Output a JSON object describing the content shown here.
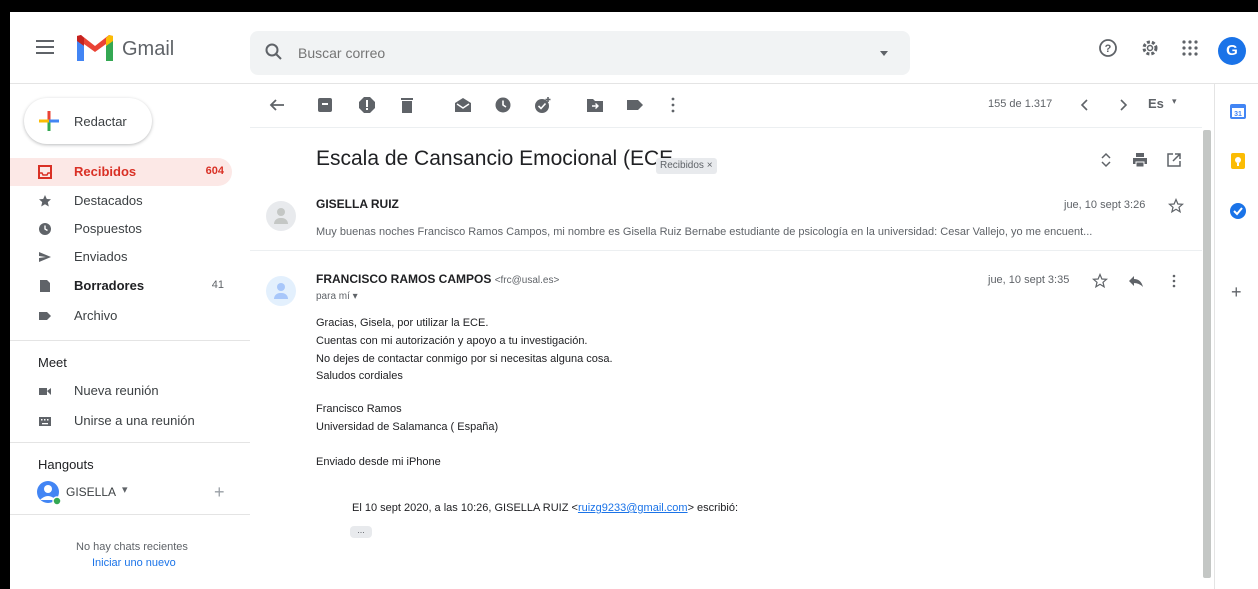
{
  "header": {
    "app_name": "Gmail",
    "search_placeholder": "Buscar correo",
    "avatar_letter": "G"
  },
  "sidebar": {
    "compose_label": "Redactar",
    "items": [
      {
        "label": "Recibidos",
        "count": "604",
        "icon": "inbox-icon"
      },
      {
        "label": "Destacados",
        "count": "",
        "icon": "star-icon"
      },
      {
        "label": "Pospuestos",
        "count": "",
        "icon": "clock-icon"
      },
      {
        "label": "Enviados",
        "count": "",
        "icon": "send-icon"
      },
      {
        "label": "Borradores",
        "count": "41",
        "icon": "draft-icon"
      },
      {
        "label": "Archivo",
        "count": "",
        "icon": "label-icon"
      }
    ],
    "meet": {
      "title": "Meet",
      "items": [
        {
          "label": "Nueva reunión",
          "icon": "video-icon"
        },
        {
          "label": "Unirse a una reunión",
          "icon": "keyboard-icon"
        }
      ]
    },
    "hangouts": {
      "title": "Hangouts",
      "user": "GISELLA",
      "no_chats": "No hay chats recientes",
      "start_new": "Iniciar uno nuevo"
    }
  },
  "toolbar": {
    "count": "155 de 1.317",
    "lang": "Es"
  },
  "thread": {
    "subject": "Escala de Cansancio Emocional (ECE",
    "label": "Recibidos ×",
    "messages": [
      {
        "sender": "GISELLA RUIZ",
        "date": "jue, 10 sept 3:26",
        "snippet": "Muy buenas noches Francisco Ramos Campos, mi nombre es Gisella Ruiz Bernabe estudiante de psicología en la universidad: Cesar Vallejo, yo me encuent..."
      },
      {
        "sender": "FRANCISCO RAMOS CAMPOS",
        "email": "<frc@usal.es>",
        "to": "para mí",
        "date": "jue, 10 sept 3:35",
        "body": [
          "Gracias, Gisela, por utilizar la ECE.",
          "Cuentas con mi autorización y apoyo a tu investigación.",
          "No dejes de contactar conmigo por si necesitas alguna cosa.",
          "Saludos cordiales",
          "Francisco Ramos",
          "Universidad de Salamanca ( España)",
          "Enviado desde mi iPhone"
        ],
        "quote_prefix": "El 10 sept 2020, a las 10:26, GISELLA RUIZ <",
        "quote_email": "ruizg9233@gmail.com",
        "quote_suffix": "> escribió:",
        "dots": "..."
      }
    ]
  },
  "colors": {
    "accent_red": "#d93025",
    "link_blue": "#1a73e8",
    "active_bg": "#fce8e6"
  }
}
